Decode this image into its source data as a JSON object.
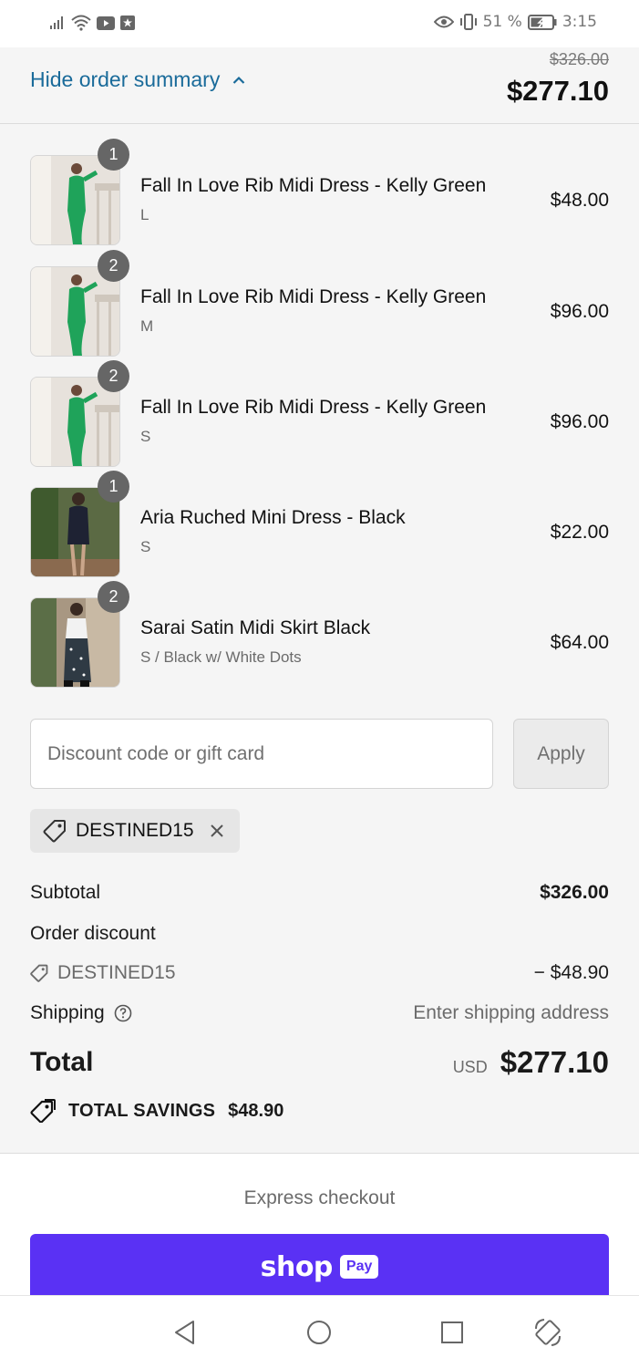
{
  "status_bar": {
    "battery_percent": "51 %",
    "time": "3:15",
    "icons": [
      "signal-icon",
      "wifi-icon",
      "youtube-icon",
      "app-icon",
      "eye-icon",
      "vibrate-icon",
      "battery-icon"
    ]
  },
  "summary": {
    "toggle_label": "Hide order summary",
    "original_total": "$326.00",
    "total": "$277.10"
  },
  "items": [
    {
      "quantity": "1",
      "title": "Fall In Love Rib Midi Dress - Kelly Green",
      "variant": "L",
      "price": "$48.00",
      "image": "green-dress-photo"
    },
    {
      "quantity": "2",
      "title": "Fall In Love Rib Midi Dress - Kelly Green",
      "variant": "M",
      "price": "$96.00",
      "image": "green-dress-photo"
    },
    {
      "quantity": "2",
      "title": "Fall In Love Rib Midi Dress - Kelly Green",
      "variant": "S",
      "price": "$96.00",
      "image": "green-dress-photo"
    },
    {
      "quantity": "1",
      "title": "Aria Ruched Mini Dress - Black",
      "variant": "S",
      "price": "$22.00",
      "image": "black-dress-photo"
    },
    {
      "quantity": "2",
      "title": "Sarai Satin Midi Skirt Black",
      "variant": "S / Black w/ White Dots",
      "price": "$64.00",
      "image": "skirt-photo"
    }
  ],
  "discount": {
    "placeholder": "Discount code or gift card",
    "apply_label": "Apply",
    "applied_code": "DESTINED15"
  },
  "totals": {
    "subtotal_label": "Subtotal",
    "subtotal_value": "$326.00",
    "order_discount_label": "Order discount",
    "discount_code": "DESTINED15",
    "discount_value": "− $48.90",
    "shipping_label": "Shipping",
    "shipping_value": "Enter shipping address",
    "total_label": "Total",
    "currency": "USD",
    "total_value": "$277.10",
    "savings_label": "TOTAL SAVINGS",
    "savings_value": "$48.90"
  },
  "express": {
    "title": "Express checkout",
    "shop_label": "shop",
    "pay_label": "Pay"
  },
  "colors": {
    "link": "#1a6b9a",
    "shop_pay": "#5a31f4",
    "badge": "#666666"
  }
}
